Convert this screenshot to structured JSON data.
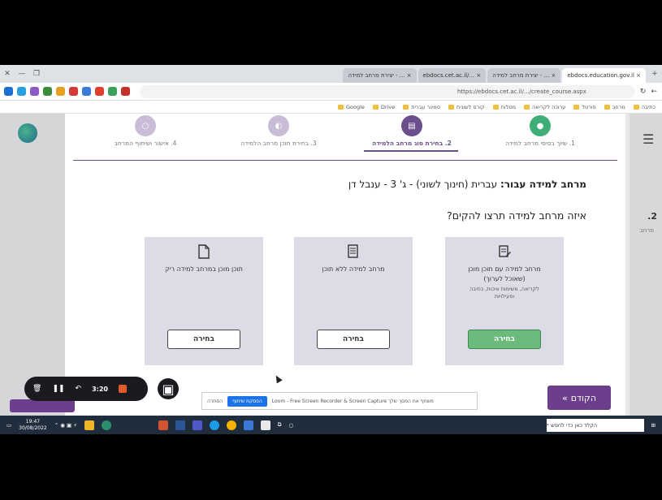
{
  "browser": {
    "tabs": [
      {
        "label": "יצירת מרחב למידה - ... ×"
      },
      {
        "label": "ebdocs.cet.ac.il/... ×"
      },
      {
        "label": "יצירת מרחב למידה - ... ×"
      },
      {
        "label": "ebdocs.education.gov.il ×"
      }
    ],
    "url": "https://ebdocs.cet.ac.il/.../create_course.aspx",
    "bookmarks": [
      "Google",
      "Drive",
      "סמינר עברית",
      "קורס לשונית",
      "מטלות",
      "ערוכה לקריאה",
      "פורטל",
      "מרחב",
      "כתיבה"
    ]
  },
  "page": {
    "menu_icon": "hamburger-icon",
    "right_number": ".2",
    "right_gray": "מרחב"
  },
  "steps": [
    {
      "label": "1. שיוך בסיסי מרחב למידה",
      "color": "#3fae76"
    },
    {
      "label": "2. בחירת סוג מרחב הלמידה",
      "color": "#6b4f8c",
      "active": true
    },
    {
      "label": "3. בחירת תוכן מרחב הלמידה",
      "color": "#b8a8c8"
    },
    {
      "label": "4. אישור ושיתוף המרחב",
      "color": "#b8a8c8"
    }
  ],
  "header": {
    "title_bold": "מרחב למידה עבור:",
    "title_rest": "עברית (חינוך לשוני) - ג' 3 - ענבל דן",
    "question": "איזה מרחב למידה תרצו להקים?"
  },
  "cards": [
    {
      "text": "מרחב למידה עם תוכן מוכן (שאוכל לערוך)",
      "sub": "לקריאה, משימות איכות, כתיבה ופעילויות",
      "button": "בחירה",
      "primary": true
    },
    {
      "text": "מרחב למידה ללא תוכן",
      "sub": "",
      "button": "בחירה",
      "primary": false
    },
    {
      "text": "תוכן מוכן במרחב למידה ריק",
      "sub": "",
      "button": "בחירה",
      "primary": false
    }
  ],
  "footer": {
    "prev_label": "הקודם",
    "prev_icon": "double-chevron-right-icon"
  },
  "loom": {
    "time": "3:20"
  },
  "share_bar": {
    "text": "Loom - Free Screen Recorder & Screen Capture משתף את המסך שלך",
    "stop_label": "הפסקת שיתוף",
    "hide_label": "הסתרה"
  },
  "taskbar": {
    "search_text": "הקלד כאן כדי לחפש",
    "clock_time": "19:47",
    "clock_date": "30/08/2022"
  }
}
